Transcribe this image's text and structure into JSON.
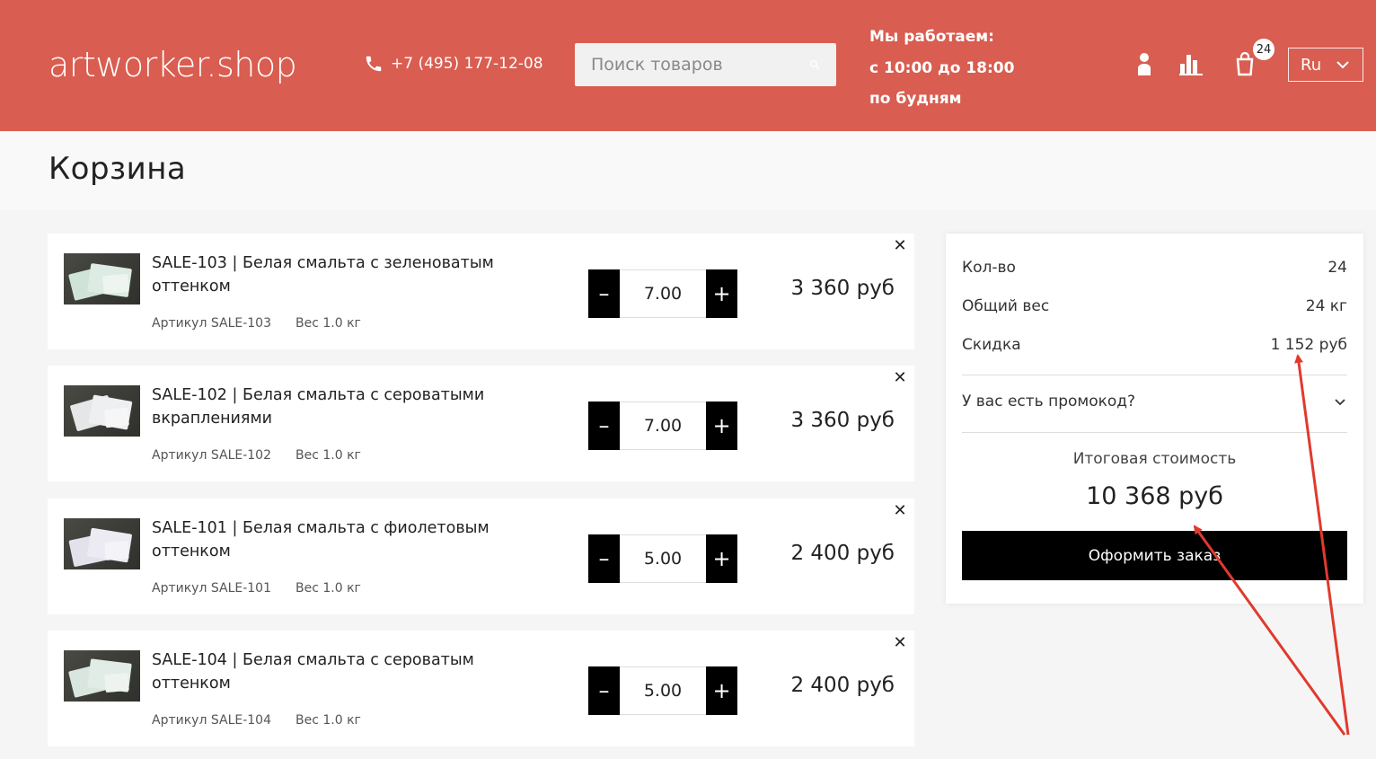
{
  "header": {
    "logo": "artworker.shop",
    "phone": "+7 (495) 177-12-08",
    "search_placeholder": "Поиск товаров",
    "hours": [
      "Мы работаем:",
      "с 10:00 до 18:00",
      "по будням"
    ],
    "cart_count": "24",
    "language": "Ru"
  },
  "page": {
    "title": "Корзина"
  },
  "items": [
    {
      "name": "SALE-103 | Белая смальта с зеленоватым оттенком",
      "sku": "Артикул SALE-103",
      "weight": "Вес 1.0 кг",
      "qty": "7.00",
      "price": "3 360 руб"
    },
    {
      "name": "SALE-102 | Белая смальта с сероватыми вкраплениями",
      "sku": "Артикул SALE-102",
      "weight": "Вес 1.0 кг",
      "qty": "7.00",
      "price": "3 360 руб"
    },
    {
      "name": "SALE-101 | Белая смальта с фиолетовым оттенком",
      "sku": "Артикул SALE-101",
      "weight": "Вес 1.0 кг",
      "qty": "5.00",
      "price": "2 400 руб"
    },
    {
      "name": "SALE-104 | Белая смальта с сероватым оттенком",
      "sku": "Артикул SALE-104",
      "weight": "Вес 1.0 кг",
      "qty": "5.00",
      "price": "2 400 руб"
    }
  ],
  "controls": {
    "minus": "–",
    "plus": "+",
    "remove": "✕"
  },
  "summary": {
    "qty_label": "Кол-во",
    "qty_value": "24",
    "weight_label": "Общий вес",
    "weight_value": "24 кг",
    "discount_label": "Скидка",
    "discount_value": "1 152 руб",
    "promo_label": "У вас есть промокод?",
    "total_label": "Итоговая стоимость",
    "total_value": "10 368 руб",
    "checkout_label": "Оформить заказ"
  },
  "colors": {
    "header": "#d95d50",
    "annotation": "#e03a2e",
    "button": "#000000"
  },
  "icons": [
    "phone-icon",
    "search-icon",
    "user-icon",
    "compare-icon",
    "cart-icon",
    "chevron-down-icon",
    "close-icon"
  ]
}
